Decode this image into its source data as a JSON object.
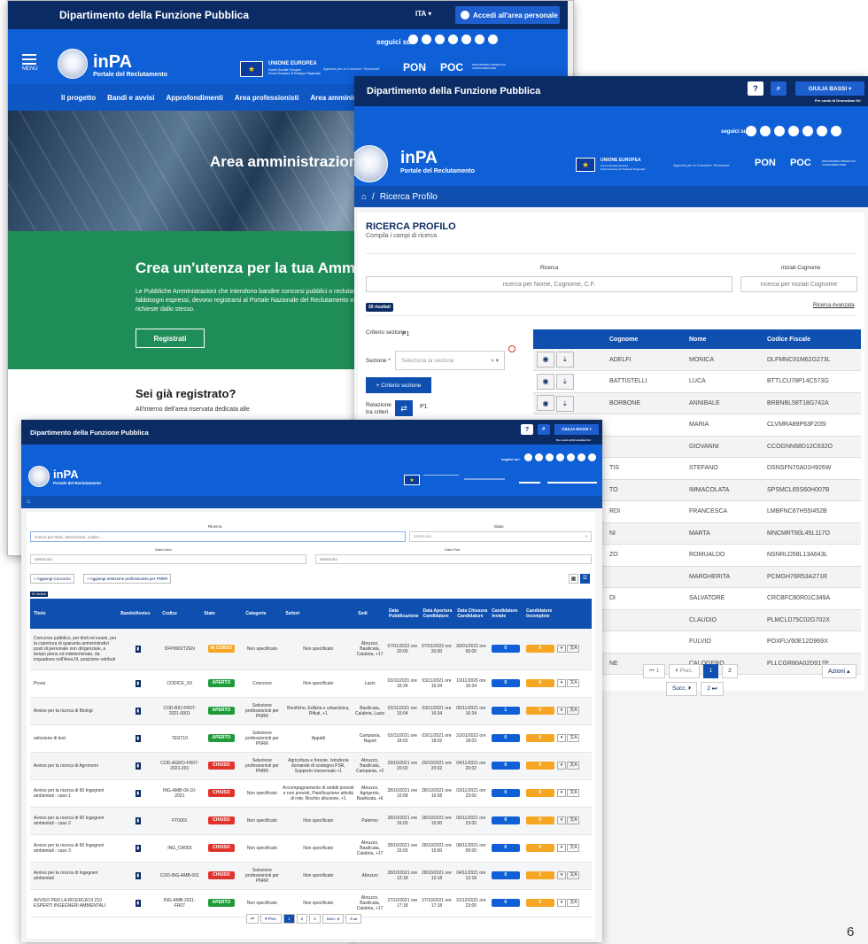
{
  "w1": {
    "dept": "Dipartimento della Funzione Pubblica",
    "lang": "ITA ▾",
    "login": "Accedi all'area personale",
    "social_label": "seguici su:",
    "menu": "MENU",
    "brand": "inPA",
    "brand_sub": "Portale del Reclutamento",
    "eu": "UNIONE EUROPEA",
    "eu_sub": "Fondo Sociale Europeo\nFondo Europeo di Sviluppo Regionale",
    "agency": "Agenzia per la Coesione Territoriale",
    "pon": "PON",
    "poc": "POC",
    "poc_sub": "PROGRAMMA OPERATIVO COMPLEMENTARE",
    "nav": [
      "Il progetto",
      "Bandi e avvisi",
      "Approfondimenti",
      "Area professionisti",
      "Area amministrazioni"
    ],
    "hero": "Area amministrazion",
    "green_title": "Crea un'utenza per la tua Ammi",
    "green_text": "Le Pubbliche Amministrazioni che intendono bandire concorsi pubblici o reclutare fabbisogni espressi, devono registrarsi al Portale Nazionale del Reclutamento ed richieste dallo stesso.",
    "register": "Registrati",
    "reg_title": "Sei già registrato?",
    "reg_text": "All'interno dell'area riservata dedicata alle"
  },
  "w2": {
    "dept": "Dipartimento della Funzione Pubblica",
    "user": "GIULIA BASSI ▾",
    "for": "Per conto di Dromedian Srl",
    "social_label": "seguici su:",
    "brand": "inPA",
    "brand_sub": "Portale del Reclutamento",
    "eu": "UNIONE EUROPEA",
    "eu_sub": "Fondo Sociale Europeo\nFondo Europeo di Sviluppo Regionale",
    "agency": "Agenzia per la Coesione Territoriale",
    "pon": "PON",
    "poc": "POC",
    "poc_sub": "PROGRAMMA OPERATIVO COMPLEMENTARE",
    "crumb": "Ricerca Profilo",
    "title": "RICERCA PROFILO",
    "subtitle": "Compila i campi di ricerca",
    "lbl_ricerca": "Ricerca",
    "lbl_iniziali": "Iniziali Cognome",
    "ph_ricerca": "ricerca per Nome, Cognome, C.F.",
    "ph_iniziali": "ricerca per iniziali Cognome",
    "results": "20 risultati",
    "advanced": "Ricerca Avanzata",
    "criterio": "Criterio sezione",
    "criterio_val": "P1",
    "sezione": "Sezione *",
    "sezione_ph": "Seleziona la sezione",
    "add_criterio": "+ Criterio sezione",
    "relazione": "Relazione tra criteri",
    "relazione_val": "P1",
    "cols": [
      "Cognome",
      "Nome",
      "Codice Fiscale"
    ],
    "rows": [
      [
        "ADELFI",
        "MONICA",
        "DLFMNC91M62G273L"
      ],
      [
        "BATTISTELLI",
        "LUCA",
        "BTTLCU78P14C573G"
      ],
      [
        "BORBONE",
        "ANNIBALE",
        "BRBNBL58T18G742A"
      ],
      [
        "",
        "MARIA",
        "CLVMRA89P63F205I"
      ],
      [
        "",
        "GIOVANNI",
        "CCOGNN68D12C632O"
      ],
      [
        "TIS",
        "STEFANO",
        "DSNSFN70A01H926W"
      ],
      [
        "TO",
        "IMMACOLATA",
        "SPSMCL65S60H007B"
      ],
      [
        "RDI",
        "FRANCESCA",
        "LMBFNC87H55I452B"
      ],
      [
        "NI",
        "MARTA",
        "MNCMRT80L45L117O"
      ],
      [
        "ZO",
        "ROMUALDO",
        "NSNRLD58L13A643L"
      ],
      [
        "",
        "MARGHERITA",
        "PCMGH76R53A271R"
      ],
      [
        "DI",
        "SALVATORE",
        "CRCBFC80R01C349A"
      ],
      [
        "",
        "CLAUDIO",
        "PLMCLD75C02G702X"
      ],
      [
        "",
        "FULVIO",
        "POXFLV60E12D969X"
      ],
      [
        "NE",
        "CALOGERO",
        "PLLCGR80A02D917P"
      ]
    ],
    "pg_first": "⏮ 1",
    "pg_prev": "⏴ Prec.",
    "pg_1": "1",
    "pg_2": "2",
    "pg_next": "Succ. ⏵",
    "pg_last": "2 ⏭",
    "azioni": "Azioni ▴"
  },
  "w3": {
    "dept": "Dipartimento della Funzione Pubblica",
    "user": "GIULIA BASSI ▾",
    "for": "Per conto di Dromedian Srl",
    "social_label": "seguici su:",
    "brand": "inPA",
    "brand_sub": "Portale del Reclutamento",
    "lbl_ricerca": "Ricerca",
    "lbl_stato": "Stato",
    "ph_ricerca": "ricerca per titolo, descrizione, codice...",
    "ph_stato": "Seleziona",
    "lbl_data_inizio": "Data inizio",
    "lbl_data_fine": "Data Fine",
    "ph_inizio": "Seleziona",
    "ph_fine": "Seleziona",
    "add_concorso": "+ Aggiungi Concorso",
    "add_selezione": "+ Aggiungi Selezione professionisti per PNRR",
    "results": "51 risultati",
    "cols": [
      "Titolo",
      "Bando/Avviso",
      "Codice",
      "Stato",
      "Categorie",
      "Settori",
      "Sedi",
      "Data Pubblicazione",
      "Data Apertura Candidature",
      "Data Chiusura Candidature",
      "Candidature Inviate",
      "Candidature Incomplete"
    ],
    "rows": [
      [
        "Concorso pubblico, per titoli ed esami, per la copertura di quaranta amministrativi posti di personale non dirigenziale, a tempo pieno ed indeterminato, da inquadrare nell'Area III, posizione retributi",
        "DFP0002TZEN",
        "IN CORSO",
        "Non specificato",
        "Non specificato",
        "Abruzzo, Basilicata, Calabria, +17",
        "07/01/2022 ore 20:00",
        "07/01/2022 ore 20:00",
        "30/01/2022 ore 00:00",
        "0",
        "0"
      ],
      [
        "Prova",
        "CODICE_XX",
        "APERTO",
        "Concorso",
        "Non specificato",
        "Lazio",
        "03/11/2021 ore 16:34",
        "03/11/2021 ore 16:34",
        "19/11/2026 ore 16:34",
        "0",
        "0"
      ],
      [
        "Avviso per la ricerca di Biologi",
        "COD-BIO-FR07-2021-0001",
        "APERTO",
        "Selezione professionisti per PNRR",
        "Bonifiche, Edilizia e urbanistica, Rifiuti, +1",
        "Basilicata, Calabria, Lazio",
        "03/11/2021 ore 16:04",
        "03/11/2021 ore 16:34",
        "06/11/2021 ore 16:34",
        "1",
        "0"
      ],
      [
        "selezione di test",
        "TEST10",
        "APERTO",
        "Selezione professionisti per PNRR",
        "Appalti",
        "Campania, Napoli",
        "03/11/2021 ore 18:02",
        "03/11/2021 ore 18:02",
        "31/01/2022 ore 18:03",
        "0",
        "0"
      ],
      [
        "Avviso per la ricerca di Agronomi",
        "COD-AGRO-FR07-2021-001",
        "CHIUSO",
        "Selezione professionisti per PNRR",
        "Agricoltura e foreste, Istruttoria domande di sostegno PSR, Supporto trasversale +1",
        "Abruzzo, Basilicata, Campania, +2",
        "29/10/2021 ore 20:02",
        "29/10/2021 ore 20:02",
        "04/11/2021 ore 20:02",
        "0",
        "0"
      ],
      [
        "Avviso per la ricerca di 60 Ingegneri ambientali - caso 1",
        "ING-AMB-09-10-2021",
        "CHIUSO",
        "Non specificato",
        "Accompagnamento di ambiti previsti e non previsti, Pianificazione attività di rete, Rischio alluvione, +1",
        "Abruzzo, Agrigento, Basilicata, +6",
        "28/10/2021 ore 16:58",
        "28/10/2021 ore 16:58",
        "03/11/2021 ore 23:00",
        "0",
        "0"
      ],
      [
        "Avviso per la ricerca di 60 Ingegneri ambientali - caso 2",
        "FT0001",
        "CHIUSO",
        "Non specificato",
        "Non specificato",
        "Palermo",
        "28/10/2021 ore 16:03",
        "28/10/2021 ore 15:00",
        "06/11/2021 ore 23:00",
        "0",
        "0"
      ],
      [
        "Avviso per la ricerca di 60 Ingegneri ambientali - caso 3",
        "ING_CR003",
        "CHIUSO",
        "Non specificato",
        "Non specificato",
        "Abruzzo, Basilicata, Calabria, +17",
        "28/10/2021 ore 15:03",
        "28/10/2021 ore 15:00",
        "08/11/2021 ore 00:00",
        "0",
        "0"
      ],
      [
        "Avviso per la ricerca di Ingegneri ambientali",
        "COD-ING-AMB-001",
        "CHIUSO",
        "Selezione professionisti per PNRR",
        "Non specificato",
        "Abruzzo",
        "28/10/2021 ore 12:18",
        "28/10/2021 ore 12:18",
        "04/11/2021 ore 12:18",
        "0",
        "1"
      ],
      [
        "AVVISO PER LA RICERCA DI 210 ESPERTI INGEGNERI AMBIENTALI",
        "ING-AMB-2021-FR07",
        "APERTO",
        "Non specificato",
        "Non specificato",
        "Abruzzo, Basilicata, Calabria, +17",
        "27/10/2021 ore 17:18",
        "27/10/2021 ore 17:18",
        "31/12/2021 ore 23:00",
        "0",
        "0"
      ]
    ],
    "pager": [
      "⏮",
      "⏴ Prec.",
      "1",
      "2",
      "3",
      "Succ. ⏵",
      "6 ⏭"
    ]
  },
  "page_number": "6"
}
